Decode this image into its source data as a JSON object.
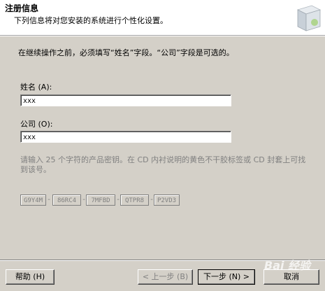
{
  "header": {
    "title": "注册信息",
    "subtitle": "下列信息将对您安装的系统进行个性化设置。"
  },
  "instruction": "在继续操作之前，必须填写“姓名”字段。“公司”字段是可选的。",
  "form": {
    "name_label": "姓名 (A):",
    "name_value": "xxx",
    "company_label": "公司 (O):",
    "company_value": "xxx"
  },
  "product_key": {
    "note": "请输入 25 个字符的产品密钥。在 CD 内衬说明的黄色不干胶标签或 CD 封套上可找到该号。",
    "segments": [
      "G9Y4M",
      "86RC4",
      "7MFBD",
      "QTPR8",
      "P2VD3"
    ]
  },
  "buttons": {
    "help": "帮助 (H)",
    "back": "< 上一步 (B)",
    "next": "下一步 (N) >",
    "cancel": "取消"
  },
  "watermark": "Bai 经验",
  "colors": {
    "dialog_bg": "#d4d0c8",
    "header_bg": "#ffffff",
    "disabled_text": "#808080"
  }
}
